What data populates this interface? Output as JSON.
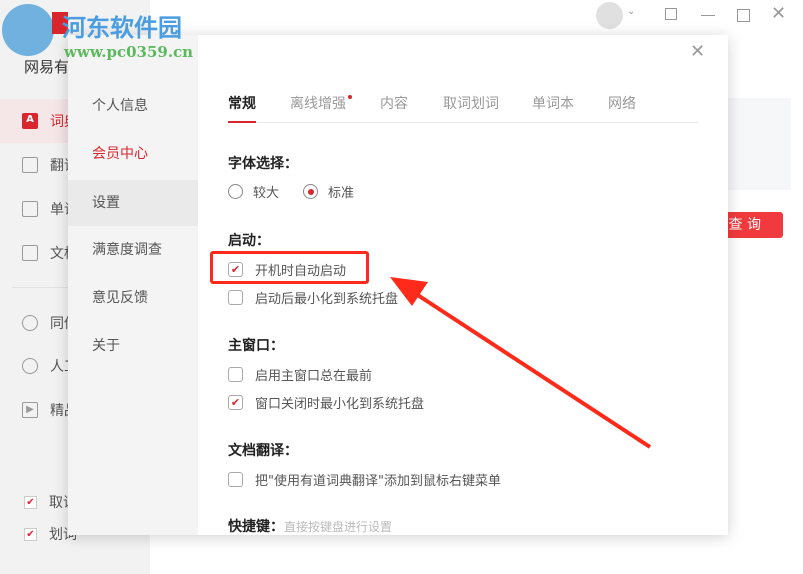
{
  "watermark": {
    "title": "河东软件园",
    "url": "www.pc0359.cn"
  },
  "app": {
    "name": "网易有",
    "sidebar": [
      {
        "label": "词典",
        "icon": "dict-icon"
      },
      {
        "label": "翻译",
        "icon": "translate-icon"
      },
      {
        "label": "单词",
        "icon": "wordbook-icon"
      },
      {
        "label": "文档",
        "icon": "document-icon"
      },
      {
        "label": "同传",
        "icon": "cloud-icon"
      },
      {
        "label": "人工",
        "icon": "human-icon"
      },
      {
        "label": "精品",
        "icon": "video-icon"
      }
    ],
    "checks": [
      {
        "label": "取词",
        "checked": true
      },
      {
        "label": "划词",
        "checked": true
      }
    ],
    "query_button": "查 询"
  },
  "dialog": {
    "nav": [
      "个人信息",
      "会员中心",
      "设置",
      "满意度调查",
      "意见反馈",
      "关于"
    ],
    "tabs": [
      "常规",
      "离线增强",
      "内容",
      "取词划词",
      "单词本",
      "网络"
    ],
    "font_section": "字体选择：",
    "font_options": [
      "较大",
      "标准"
    ],
    "font_selected": "标准",
    "startup_section": "启动：",
    "startup_options": [
      {
        "label": "开机时自动启动",
        "checked": true
      },
      {
        "label": "启动后最小化到系统托盘",
        "checked": false
      }
    ],
    "main_section": "主窗口：",
    "main_options": [
      {
        "label": "启用主窗口总在最前",
        "checked": false
      },
      {
        "label": "窗口关闭时最小化到系统托盘",
        "checked": true
      }
    ],
    "doc_section": "文档翻译：",
    "doc_options": [
      {
        "label": "把\"使用有道词典翻译\"添加到鼠标右键菜单",
        "checked": false
      }
    ],
    "hotkey_section": "快捷键：",
    "hotkey_hint": "直接按键盘进行设置"
  },
  "colors": {
    "accent": "#d9262e",
    "highlight": "#ff2a1a"
  }
}
